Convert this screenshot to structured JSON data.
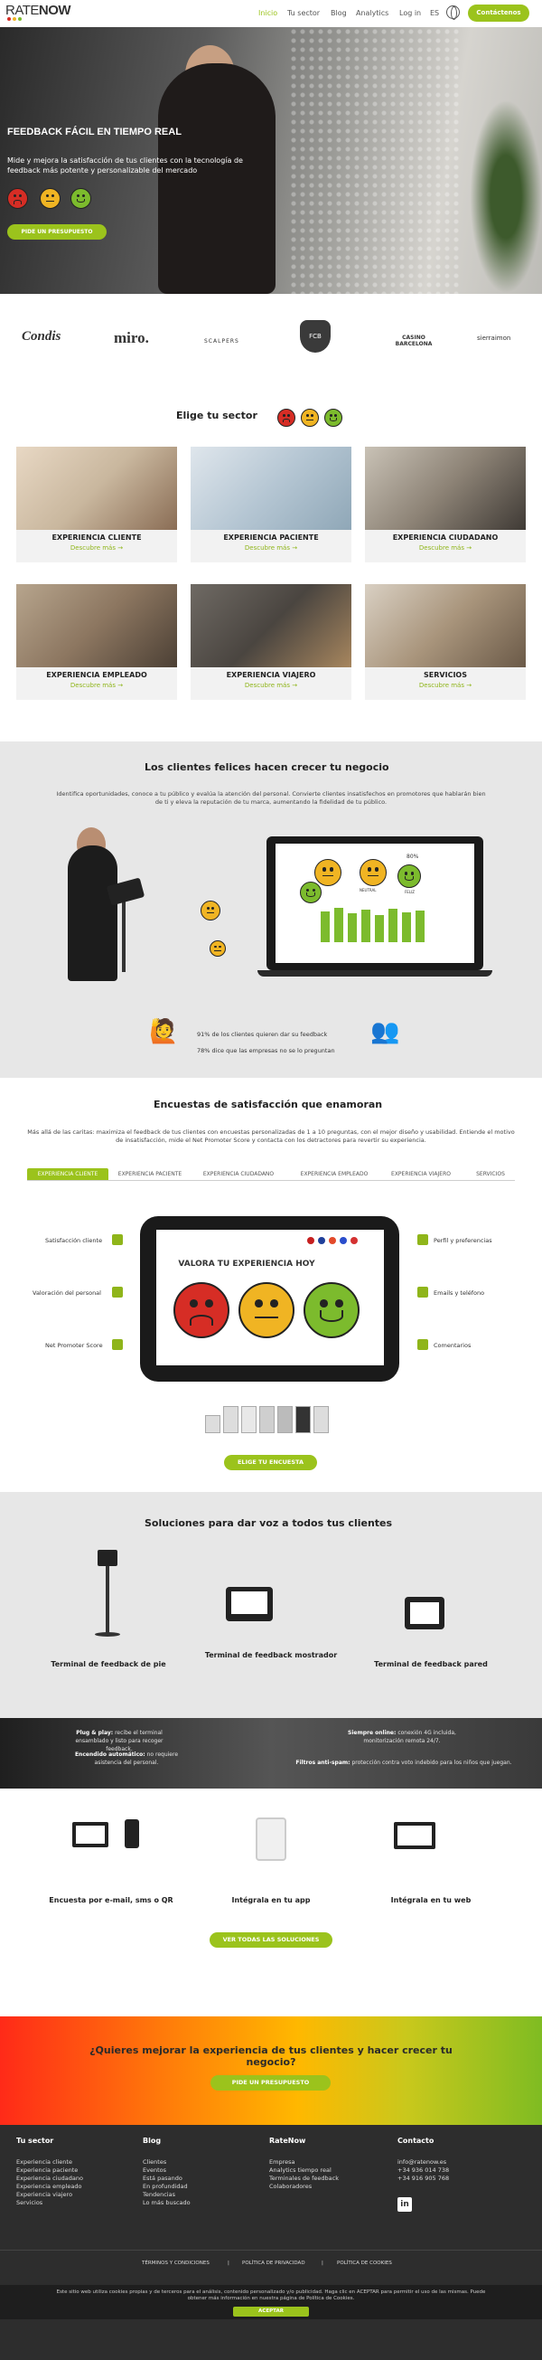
{
  "brand": {
    "name_light": "RATE",
    "name_bold": "NOW",
    "dot_colors": [
      "#d62d25",
      "#f0b423",
      "#7cbb2d"
    ]
  },
  "nav": {
    "items": [
      "Inicio",
      "Tu sector",
      "Blog",
      "Analytics",
      "Log in",
      "ES"
    ],
    "cta": "Contáctenos"
  },
  "hero": {
    "title": "FEEDBACK FÁCIL EN TIEMPO REAL",
    "subtitle": "Mide y mejora la satisfacción de tus clientes con la tecnología de feedback más potente y personalizable del mercado",
    "cta": "PIDE UN PRESUPUESTO"
  },
  "clients": [
    "Condis",
    "miro.",
    "SCALPERS",
    "FCB",
    "CASINO BARCELONA",
    "sierraimon"
  ],
  "sectors": {
    "title": "Elige tu sector",
    "more": "Descubre más →",
    "items": [
      "EXPERIENCIA CLIENTE",
      "EXPERIENCIA PACIENTE",
      "EXPERIENCIA CIUDADANO",
      "EXPERIENCIA EMPLEADO",
      "EXPERIENCIA VIAJERO",
      "SERVICIOS"
    ]
  },
  "happy": {
    "title": "Los clientes felices hacen crecer tu negocio",
    "desc": "Identifica oportunidades, conoce a tu público y evalúa la atención del personal. Convierte clientes insatisfechos en promotores que hablarán bien de ti y eleva la reputación de tu marca, aumentando la fidelidad de tu público.",
    "stat1": "91% de los clientes quieren dar su feedback",
    "stat2": "78% dice que las empresas no se lo preguntan",
    "chart_pct": "80%",
    "chart_labels": [
      "NEUTRAL",
      "FELIZ"
    ]
  },
  "surveys": {
    "title": "Encuestas de satisfacción que enamoran",
    "desc": "Más allá de las caritas: maximiza el feedback de tus clientes con encuestas personalizadas de 1 a 10 preguntas, con el mejor diseño y usabilidad. Entiende el motivo de insatisfacción, mide el Net Promoter Score y contacta con los detractores para revertir su experiencia.",
    "tabs": [
      "EXPERIENCIA CLIENTE",
      "EXPERIENCIA PACIENTE",
      "EXPERIENCIA CIUDADANO",
      "EXPERIENCIA EMPLEADO",
      "EXPERIENCIA VIAJERO",
      "SERVICIOS"
    ],
    "screen_title": "VALORA TU EXPERIENCIA HOY",
    "features_left": [
      "Satisfacción cliente",
      "Valoración del personal",
      "Net Promoter Score"
    ],
    "features_right": [
      "Perfil y preferencias",
      "Emails y teléfono",
      "Comentarios"
    ],
    "cta": "ELIGE TU ENCUESTA"
  },
  "solutions": {
    "title": "Soluciones para dar voz a todos tus clientes",
    "items": [
      "Terminal de feedback de pie",
      "Terminal de feedback mostrador",
      "Terminal de feedback pared"
    ]
  },
  "features_band": {
    "plug_title": "Plug & play:",
    "plug_text": "recibe el terminal ensamblado y listo para recoger feedback.",
    "auto_title": "Encendido automático:",
    "auto_text": "no requiere asistencia del personal.",
    "online_title": "Siempre online:",
    "online_text": "conexión 4G incluida, monitorización remota 24/7.",
    "spam_title": "Filtros anti-spam:",
    "spam_text": "protección contra voto indebido para los niños que juegan."
  },
  "channels": {
    "items": [
      "Encuesta por e-mail, sms o QR",
      "Intégrala en tu app",
      "Intégrala en tu web"
    ],
    "cta": "VER TODAS LAS SOLUCIONES"
  },
  "cta_band": {
    "title": "¿Quieres mejorar la experiencia de tus clientes y hacer crecer tu negocio?",
    "cta": "PIDE UN PRESUPUESTO"
  },
  "footer": {
    "col1": {
      "title": "Tu sector",
      "items": [
        "Experiencia cliente",
        "Experiencia paciente",
        "Experiencia ciudadano",
        "Experiencia empleado",
        "Experiencia viajero",
        "Servicios"
      ]
    },
    "col2": {
      "title": "Blog",
      "items": [
        "Clientes",
        "Eventos",
        "Está pasando",
        "En profundidad",
        "Tendencias",
        "Lo más buscado"
      ]
    },
    "col3": {
      "title": "RateNow",
      "items": [
        "Empresa",
        "Analytics tiempo real",
        "Terminales de feedback",
        "Colaboradores"
      ]
    },
    "col4": {
      "title": "Contacto",
      "items": [
        "info@ratenow.es",
        "+34 936 014 738",
        "+34 916 905 768"
      ]
    },
    "legal": [
      "TÉRMINOS Y CONDICIONES",
      "|",
      "POLÍTICA DE PRIVACIDAD",
      "|",
      "POLÍTICA DE COOKIES"
    ]
  },
  "cookie": {
    "text": "Este sitio web utiliza cookies propias y de terceros para el análisis, contenido personalizado y/o publicidad. Haga clic en ACEPTAR para permitir el uso de las mismas. Puede obtener más información en nuestra página de Política de Cookies.",
    "accept": "ACEPTAR"
  },
  "colors": {
    "accent": "#9bc31c",
    "red": "#d62d25",
    "yellow": "#f0b423",
    "green": "#7cbb2d"
  }
}
